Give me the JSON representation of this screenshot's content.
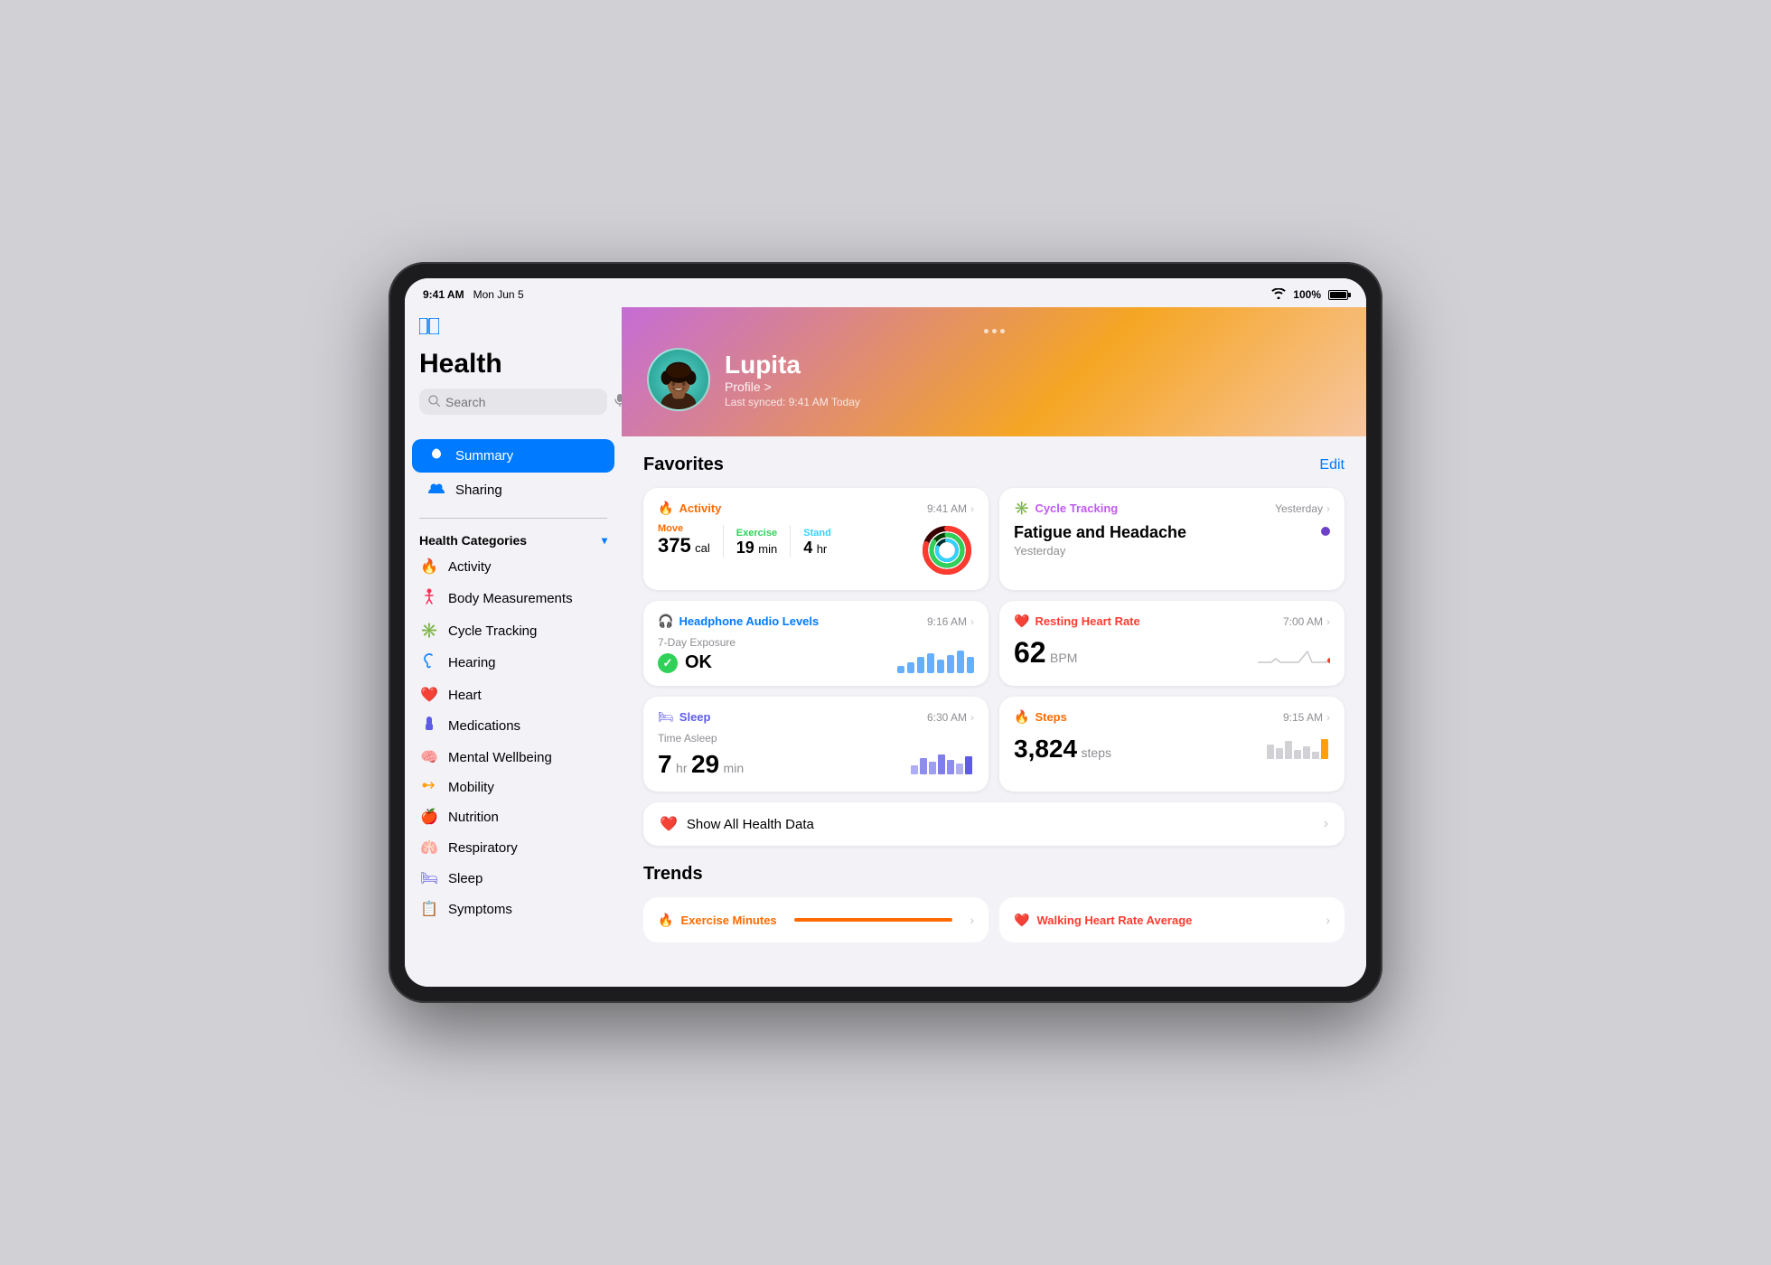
{
  "device": {
    "time": "9:41 AM",
    "date": "Mon Jun 5",
    "wifi_label": "WiFi",
    "battery_percent": "100%"
  },
  "sidebar": {
    "title": "Health",
    "search_placeholder": "Search",
    "toolbar_icon": "⊞",
    "nav_items": [
      {
        "id": "summary",
        "icon": "❤️",
        "label": "Summary",
        "active": true
      },
      {
        "id": "sharing",
        "icon": "👥",
        "label": "Sharing",
        "active": false
      }
    ],
    "categories_title": "Health Categories",
    "categories": [
      {
        "id": "activity",
        "icon": "🔥",
        "label": "Activity",
        "color": "#ff6b00"
      },
      {
        "id": "body",
        "icon": "🧍",
        "label": "Body Measurements",
        "color": "#ff2d55"
      },
      {
        "id": "cycle",
        "icon": "✳️",
        "label": "Cycle Tracking",
        "color": "#bf5af2"
      },
      {
        "id": "hearing",
        "icon": "👂",
        "label": "Hearing",
        "color": "#007aff"
      },
      {
        "id": "heart",
        "icon": "❤️",
        "label": "Heart",
        "color": "#ff3b30"
      },
      {
        "id": "medications",
        "icon": "💊",
        "label": "Medications",
        "color": "#5e5ce6"
      },
      {
        "id": "mental",
        "icon": "🧠",
        "label": "Mental Wellbeing",
        "color": "#30d158"
      },
      {
        "id": "mobility",
        "icon": "➡️",
        "label": "Mobility",
        "color": "#ff9f0a"
      },
      {
        "id": "nutrition",
        "icon": "🍎",
        "label": "Nutrition",
        "color": "#30d158"
      },
      {
        "id": "respiratory",
        "icon": "🫁",
        "label": "Respiratory",
        "color": "#64d2ff"
      },
      {
        "id": "sleep",
        "icon": "🛏",
        "label": "Sleep",
        "color": "#5e5ce6"
      },
      {
        "id": "symptoms",
        "icon": "📋",
        "label": "Symptoms",
        "color": "#ff9f0a"
      }
    ]
  },
  "profile": {
    "name": "Lupita",
    "link_text": "Profile >",
    "sync_text": "Last synced: 9:41 AM Today"
  },
  "favorites": {
    "section_title": "Favorites",
    "edit_label": "Edit",
    "cards": {
      "activity": {
        "title": "Activity",
        "time": "9:41 AM",
        "move_label": "Move",
        "move_value": "375",
        "move_unit": "cal",
        "exercise_label": "Exercise",
        "exercise_value": "19",
        "exercise_unit": "min",
        "stand_label": "Stand",
        "stand_value": "4",
        "stand_unit": "hr"
      },
      "cycle": {
        "title": "Cycle Tracking",
        "time": "Yesterday",
        "symptom": "Fatigue and Headache",
        "subtitle": "Yesterday"
      },
      "headphone": {
        "title": "Headphone Audio Levels",
        "time": "9:16 AM",
        "exposure_label": "7-Day Exposure",
        "status": "OK"
      },
      "heart": {
        "title": "Resting Heart Rate",
        "time": "7:00 AM",
        "value": "62",
        "unit": "BPM"
      },
      "sleep": {
        "title": "Sleep",
        "time": "6:30 AM",
        "label": "Time Asleep",
        "hours": "7",
        "minutes": "29",
        "hr_label": "hr",
        "min_label": "min"
      },
      "steps": {
        "title": "Steps",
        "time": "9:15 AM",
        "value": "3,824",
        "unit": "steps"
      }
    }
  },
  "show_all": {
    "text": "Show All Health Data",
    "icon": "❤️"
  },
  "trends": {
    "section_title": "Trends",
    "items": [
      {
        "id": "exercise",
        "icon": "🔥",
        "label": "Exercise Minutes",
        "color": "#ff6b00"
      },
      {
        "id": "walking_hr",
        "icon": "❤️",
        "label": "Walking Heart Rate Average",
        "color": "#ff3b30"
      }
    ]
  },
  "icons": {
    "chevron_down": "▾",
    "chevron_right": "›",
    "search": "🔍",
    "mic": "🎤",
    "wifi": "▲",
    "heart_filled": "♥",
    "check": "✓"
  }
}
